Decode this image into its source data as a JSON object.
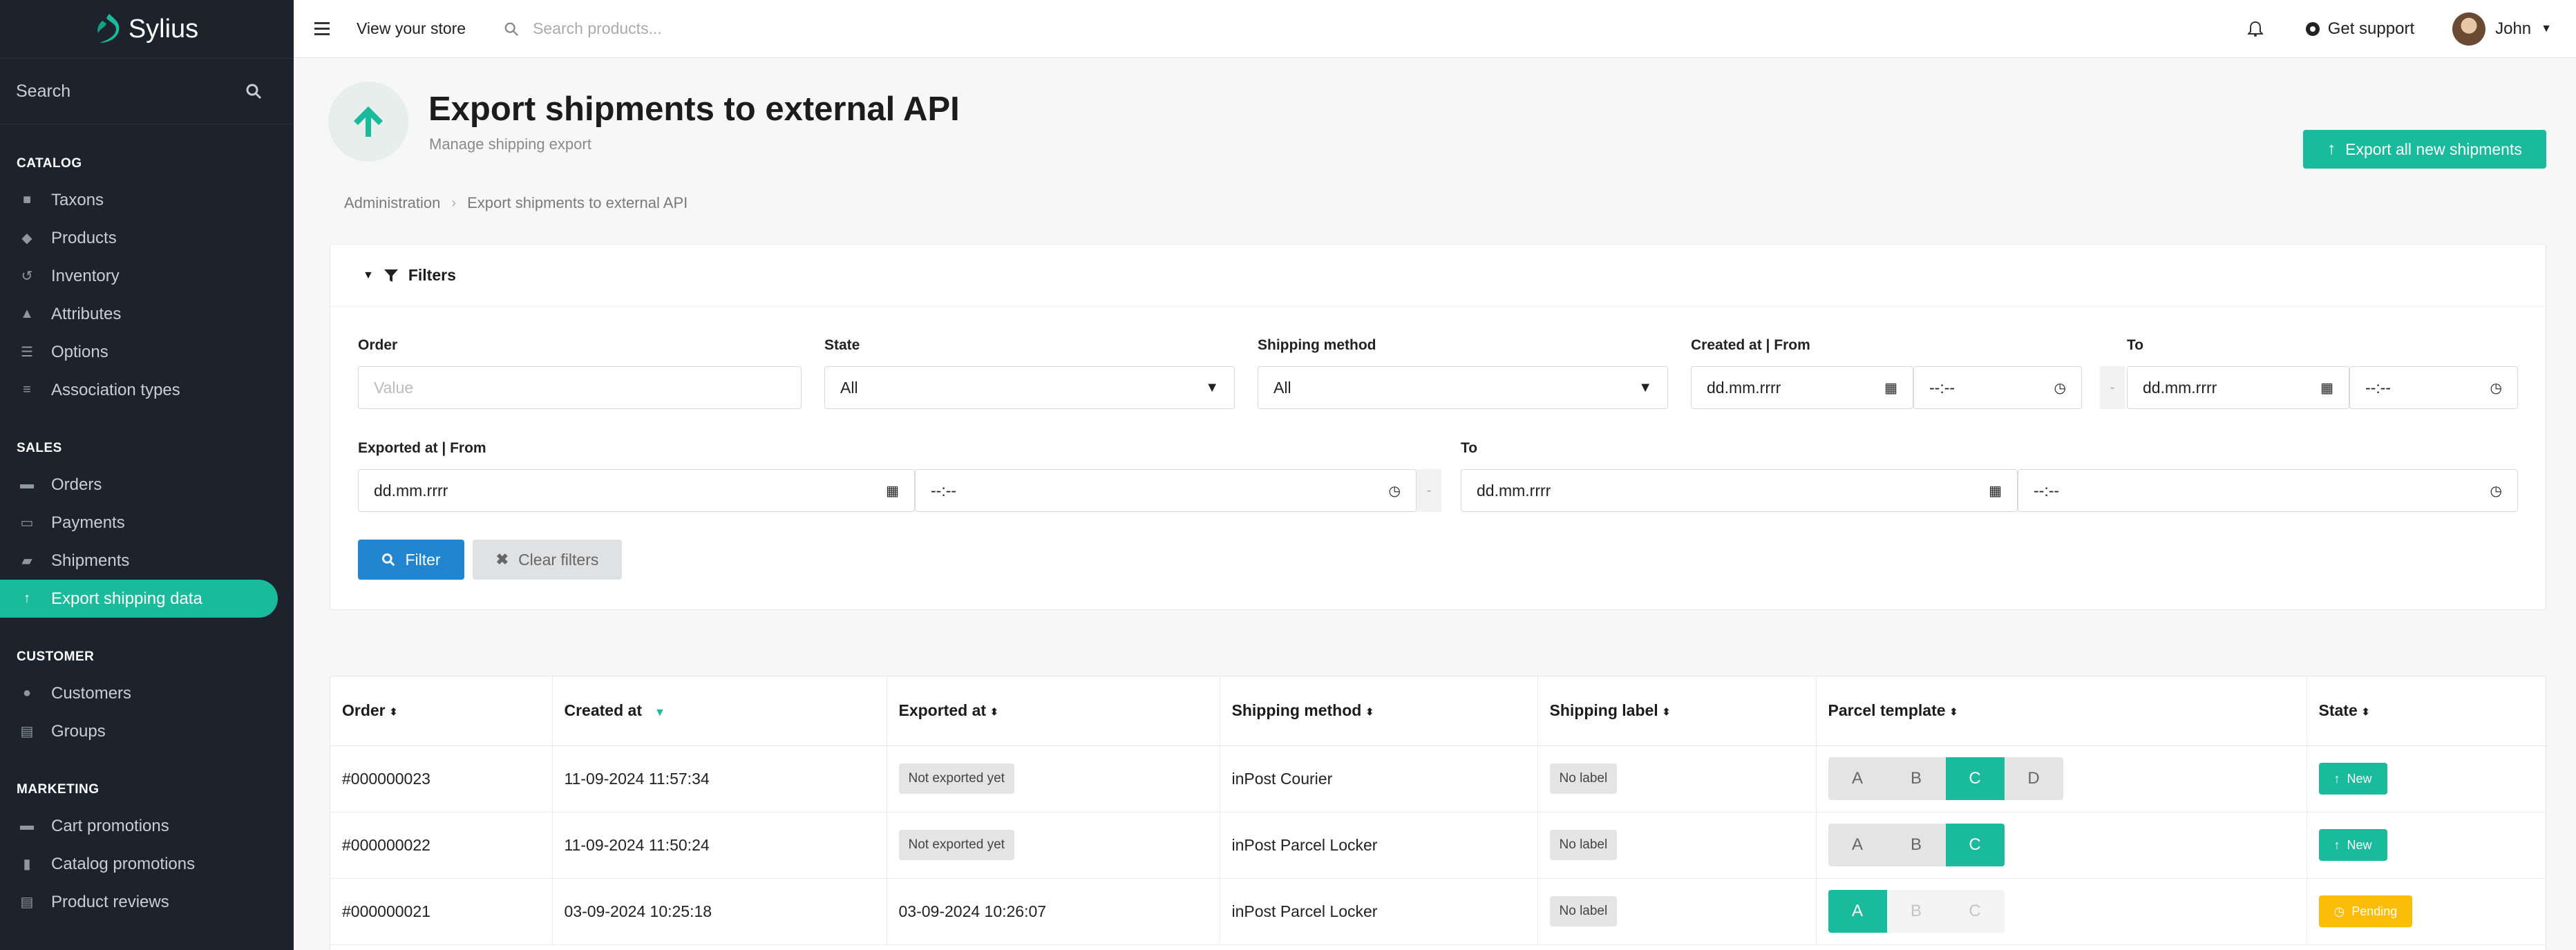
{
  "brand": {
    "name": "Sylius",
    "accent": "#1abb9c",
    "sidebar_bg": "#1c232c"
  },
  "sidebar": {
    "search_placeholder": "Search",
    "sections": {
      "catalog": {
        "title": "CATALOG",
        "items": [
          "Taxons",
          "Products",
          "Inventory",
          "Attributes",
          "Options",
          "Association types"
        ]
      },
      "sales": {
        "title": "SALES",
        "items": [
          "Orders",
          "Payments",
          "Shipments",
          "Export shipping data"
        ]
      },
      "customer": {
        "title": "CUSTOMER",
        "items": [
          "Customers",
          "Groups"
        ]
      },
      "marketing": {
        "title": "MARKETING",
        "items": [
          "Cart promotions",
          "Catalog promotions",
          "Product reviews"
        ]
      }
    },
    "active_item": "Export shipping data"
  },
  "topbar": {
    "view_store": "View your store",
    "search_placeholder": "Search products...",
    "support": "Get support",
    "user": "John"
  },
  "header": {
    "title": "Export shipments to external API",
    "subtitle": "Manage shipping export",
    "export_all_button": "Export all new shipments"
  },
  "breadcrumb": [
    "Administration",
    "Export shipments to external API"
  ],
  "filters": {
    "title": "Filters",
    "order": {
      "label": "Order",
      "placeholder": "Value"
    },
    "state": {
      "label": "State",
      "value": "All"
    },
    "shipping_method": {
      "label": "Shipping method",
      "value": "All"
    },
    "created_at": {
      "label": "Created at | From",
      "to_label": "To",
      "date_placeholder": "dd.mm.rrrr",
      "time_placeholder": "--:--"
    },
    "exported_at": {
      "label": "Exported at | From",
      "to_label": "To",
      "date_placeholder": "dd.mm.rrrr",
      "time_placeholder": "--:--"
    },
    "separator": "-",
    "filter_button": "Filter",
    "clear_button": "Clear filters"
  },
  "table": {
    "columns": [
      "Order",
      "Created at",
      "Exported at",
      "Shipping method",
      "Shipping label",
      "Parcel template",
      "State"
    ],
    "rows": [
      {
        "order": "#000000023",
        "created": "11-09-2024 11:57:34",
        "exported": "Not exported yet",
        "method": "inPost Courier",
        "label": "No label",
        "templates": [
          "A",
          "B",
          "C",
          "D"
        ],
        "state": "New"
      },
      {
        "order": "#000000022",
        "created": "11-09-2024 11:50:24",
        "exported": "Not exported yet",
        "method": "inPost Parcel Locker",
        "label": "No label",
        "templates": [
          "A",
          "B",
          "C"
        ],
        "state": "New"
      },
      {
        "order": "#000000021",
        "created": "03-09-2024 10:25:18",
        "exported": "03-09-2024 10:26:07",
        "method": "inPost Parcel Locker",
        "label": "No label",
        "templates": [
          "A",
          "B",
          "C"
        ],
        "state": "Pending"
      }
    ]
  }
}
